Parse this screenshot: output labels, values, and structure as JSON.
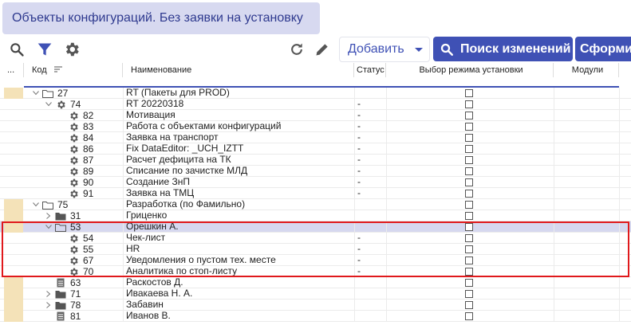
{
  "window": {
    "title": "Объекты конфигураций. Без заявки на установку"
  },
  "toolbar": {
    "add_label": "Добавить",
    "search_changes_label": "Поиск изменений",
    "form_label": "Сформир"
  },
  "colors": {
    "accent": "#3f51b5",
    "tab_bg": "#d7d9f0",
    "marker": "#f4e2b8",
    "selected_row": "#d6d8ef",
    "highlight": "#e0191c"
  },
  "grid": {
    "columns": {
      "menu": "...",
      "code": "Код",
      "name": "Наименование",
      "status": "Статус",
      "mode": "Выбор режима установки",
      "modules": "Модули"
    },
    "rows": [
      {
        "code": "27",
        "name": "RT (Пакеты для PROD)",
        "status": "",
        "type": "folder-open",
        "level": 1,
        "expand": "expanded",
        "marker": true
      },
      {
        "code": "74",
        "name": "RT 20220318",
        "status": "-",
        "type": "gear",
        "level": 2,
        "expand": "expanded",
        "marker": false
      },
      {
        "code": "82",
        "name": "Мотивация",
        "status": "-",
        "type": "gear",
        "level": 3,
        "expand": "none",
        "marker": false
      },
      {
        "code": "83",
        "name": "Работа с объектами конфигураций",
        "status": "-",
        "type": "gear",
        "level": 3,
        "expand": "none",
        "marker": false
      },
      {
        "code": "84",
        "name": "Заявка на транспорт",
        "status": "-",
        "type": "gear",
        "level": 3,
        "expand": "none",
        "marker": false
      },
      {
        "code": "86",
        "name": "Fix DataEditor: _UCH_IZTT",
        "status": "-",
        "type": "gear",
        "level": 3,
        "expand": "none",
        "marker": false
      },
      {
        "code": "87",
        "name": "Расчет дефицита на ТК",
        "status": "-",
        "type": "gear",
        "level": 3,
        "expand": "none",
        "marker": false
      },
      {
        "code": "89",
        "name": "Списание по зачистке МЛД",
        "status": "-",
        "type": "gear",
        "level": 3,
        "expand": "none",
        "marker": false
      },
      {
        "code": "90",
        "name": "Создание ЗнП",
        "status": "-",
        "type": "gear",
        "level": 3,
        "expand": "none",
        "marker": false
      },
      {
        "code": "91",
        "name": "Заявка на ТМЦ",
        "status": "-",
        "type": "gear",
        "level": 3,
        "expand": "none",
        "marker": false
      },
      {
        "code": "75",
        "name": "Разработка (по Фамильно)",
        "status": "",
        "type": "folder-open",
        "level": 1,
        "expand": "expanded",
        "marker": true
      },
      {
        "code": "31",
        "name": "Гриценко",
        "status": "",
        "type": "folder",
        "level": 2,
        "expand": "collapsed",
        "marker": true
      },
      {
        "code": "53",
        "name": "Орешкин А.",
        "status": "",
        "type": "folder-open",
        "level": 2,
        "expand": "expanded",
        "marker": true,
        "selected": true
      },
      {
        "code": "54",
        "name": "Чек-лист",
        "status": "-",
        "type": "gear",
        "level": 3,
        "expand": "none",
        "marker": false
      },
      {
        "code": "55",
        "name": "HR",
        "status": "-",
        "type": "gear",
        "level": 3,
        "expand": "none",
        "marker": false
      },
      {
        "code": "67",
        "name": "Уведомления о пустом тех. месте",
        "status": "-",
        "type": "gear",
        "level": 3,
        "expand": "none",
        "marker": false
      },
      {
        "code": "70",
        "name": "Аналитика по стоп-листу",
        "status": "-",
        "type": "gear",
        "level": 3,
        "expand": "none",
        "marker": false
      },
      {
        "code": "63",
        "name": "Раскостов Д.",
        "status": "",
        "type": "doc",
        "level": 2,
        "expand": "none",
        "marker": true
      },
      {
        "code": "71",
        "name": "Ивакаева Н. А.",
        "status": "",
        "type": "folder",
        "level": 2,
        "expand": "collapsed",
        "marker": true
      },
      {
        "code": "78",
        "name": "Забавин",
        "status": "",
        "type": "folder",
        "level": 2,
        "expand": "collapsed",
        "marker": true
      },
      {
        "code": "81",
        "name": "Иванов В.",
        "status": "",
        "type": "doc",
        "level": 2,
        "expand": "none",
        "marker": true
      }
    ]
  }
}
